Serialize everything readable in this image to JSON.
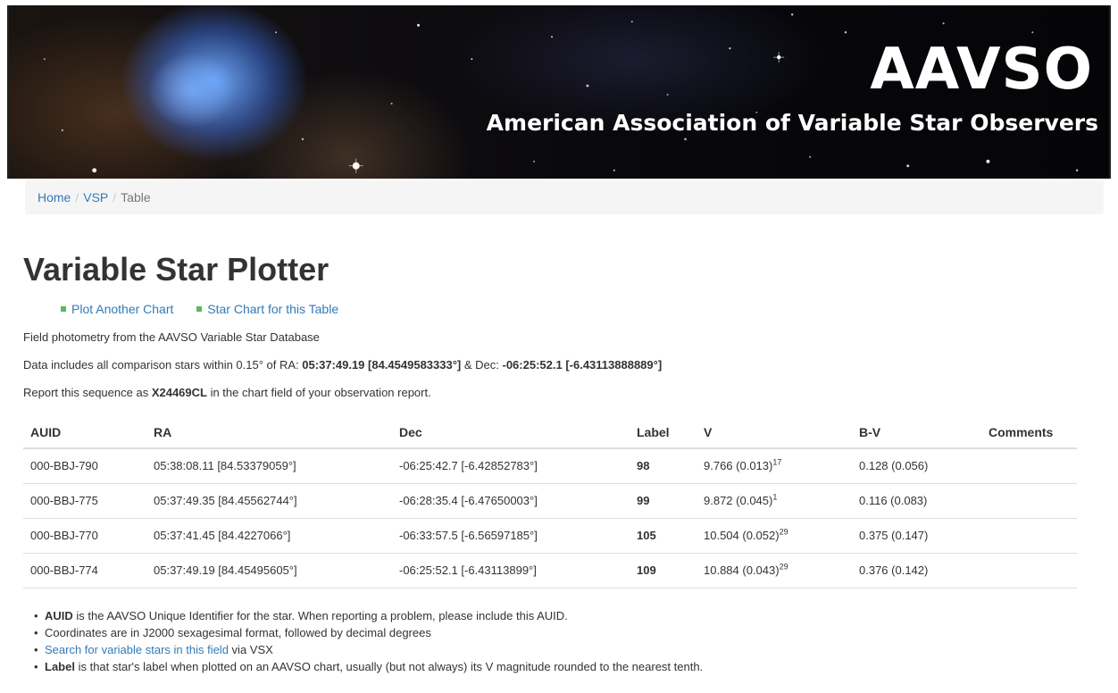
{
  "header": {
    "title": "AAVSO",
    "subtitle": "American Association of Variable Star Observers"
  },
  "breadcrumb": {
    "home": "Home",
    "vsp": "VSP",
    "current": "Table",
    "separator": "/"
  },
  "page": {
    "title": "Variable Star Plotter",
    "links": {
      "plot_another": "Plot Another Chart",
      "star_chart": "Star Chart for this Table"
    },
    "intro": "Field photometry from the AAVSO Variable Star Database",
    "coords": {
      "prefix": "Data includes all comparison stars within 0.15° of RA: ",
      "ra": "05:37:49.19 [84.4549583333°]",
      "mid": " & Dec: ",
      "dec": "-06:25:52.1 [-6.43113888889°]"
    },
    "report": {
      "prefix": "Report this sequence as ",
      "code": "X24469CL",
      "suffix": " in the chart field of your observation report."
    }
  },
  "table": {
    "headers": [
      "AUID",
      "RA",
      "Dec",
      "Label",
      "V",
      "B-V",
      "Comments"
    ],
    "rows": [
      {
        "auid": "000-BBJ-790",
        "ra": "05:38:08.11 [84.53379059°]",
        "dec": "-06:25:42.7 [-6.42852783°]",
        "label": "98",
        "v": "9.766 (0.013)",
        "v_sup": "17",
        "bv": "0.128 (0.056)",
        "comments": ""
      },
      {
        "auid": "000-BBJ-775",
        "ra": "05:37:49.35 [84.45562744°]",
        "dec": "-06:28:35.4 [-6.47650003°]",
        "label": "99",
        "v": "9.872 (0.045)",
        "v_sup": "1",
        "bv": "0.116 (0.083)",
        "comments": ""
      },
      {
        "auid": "000-BBJ-770",
        "ra": "05:37:41.45 [84.4227066°]",
        "dec": "-06:33:57.5 [-6.56597185°]",
        "label": "105",
        "v": "10.504 (0.052)",
        "v_sup": "29",
        "bv": "0.375 (0.147)",
        "comments": ""
      },
      {
        "auid": "000-BBJ-774",
        "ra": "05:37:49.19 [84.45495605°]",
        "dec": "-06:25:52.1 [-6.43113899°]",
        "label": "109",
        "v": "10.884 (0.043)",
        "v_sup": "29",
        "bv": "0.376 (0.142)",
        "comments": ""
      }
    ]
  },
  "notes": {
    "n1_bold": "AUID",
    "n1_text": " is the AAVSO Unique Identifier for the star. When reporting a problem, please include this AUID.",
    "n2_text": "Coordinates are in J2000 sexagesimal format, followed by decimal degrees",
    "n3_link": "Search for variable stars in this field",
    "n3_text": " via VSX",
    "n4_bold": "Label",
    "n4_text": " is that star's label when plotted on an AAVSO chart, usually (but not always) its V magnitude rounded to the nearest tenth."
  },
  "colors": {
    "link": "#337ab7",
    "bullet_square": "#5cb85c",
    "breadcrumb_bg": "#f5f5f5"
  }
}
